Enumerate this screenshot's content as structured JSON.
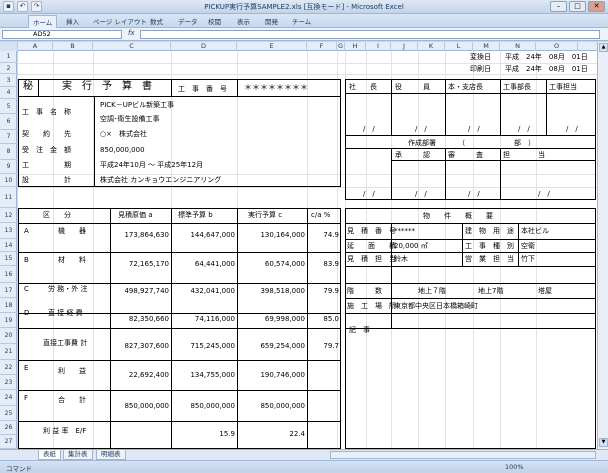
{
  "window": {
    "title": "PICKUP実行予算SAMPLE2.xls [互換モード] - Microsoft Excel",
    "minimize": "–",
    "maximize": "□",
    "close": "✕"
  },
  "qat": {
    "undo": "↶",
    "redo": "↷",
    "save": "▪"
  },
  "ribbon": {
    "tabs": [
      "ホーム",
      "挿入",
      "ページ レイアウト",
      "数式",
      "データ",
      "校閲",
      "表示",
      "開発",
      "チーム"
    ]
  },
  "formula_bar": {
    "name_box": "AD52",
    "fx": "fx",
    "value": ""
  },
  "columns": [
    "A",
    "B",
    "C",
    "D",
    "E",
    "F",
    "G",
    "H",
    "I",
    "J",
    "K",
    "L",
    "M",
    "N",
    "O"
  ],
  "rows": [
    "1",
    "2",
    "3",
    "4",
    "5",
    "6",
    "7",
    "8",
    "9",
    "10",
    "11",
    "12",
    "13",
    "14",
    "15",
    "16",
    "17",
    "18",
    "19",
    "20",
    "21",
    "22",
    "23",
    "24",
    "25",
    "26",
    "27"
  ],
  "header": {
    "change_date_label": "変換日",
    "change_date": "平成　24年　08月　01日",
    "print_date_label": "印刷日",
    "print_date": "平成　24年　08月　01日"
  },
  "left_block": {
    "secret": "秘",
    "doc_title": "実　行　予　算　書",
    "job_no_label": "工　事　番　号",
    "job_no": "＊＊＊＊＊＊＊＊",
    "fields": [
      {
        "label": "工　事　名　称",
        "value": "PICK－UPビル新築工事"
      },
      {
        "label": "",
        "value": "空調･衛生設備工事"
      },
      {
        "label": "契　　約　　先",
        "value": "○×　株式会社"
      },
      {
        "label": "受　注　金　額",
        "value": "850,000,000"
      },
      {
        "label": "工　　　　　期",
        "value": "平成24年10月 ～ 平成25年12月"
      },
      {
        "label": "設　　　　　計",
        "value": "株式会社 カンキョウエンジニアリング"
      }
    ]
  },
  "approval": {
    "roles": [
      "社　　長",
      "役　　　員",
      "本・支店長",
      "工事部長",
      "工事担当"
    ],
    "dates": [
      "/　/",
      "/　/",
      "/　/",
      "/　/",
      "/　/"
    ],
    "dept_label": "作成部署",
    "dept_value": "（　　　　　　　部　）",
    "roles2": [
      "承　　　認",
      "審　　　査",
      "担　　　　当"
    ],
    "dates2": [
      "/　/",
      "/　/",
      "/　/",
      "/　/"
    ]
  },
  "budget": {
    "headers": [
      "区　　分",
      "見積原価 a",
      "標準予算 b",
      "実行予算 c",
      "c/a %"
    ],
    "rows": [
      {
        "code": "A",
        "name": "機　　器",
        "a": "173,864,630",
        "b": "144,647,000",
        "c": "130,164,000",
        "pct": "74.9"
      },
      {
        "code": "B",
        "name": "材　　料",
        "a": "72,165,170",
        "b": "64,441,000",
        "c": "60,574,000",
        "pct": "83.9"
      },
      {
        "code": "C",
        "name": "労 務・外 注",
        "a": "498,927,740",
        "b": "432,041,000",
        "c": "398,518,000",
        "pct": "79.9"
      },
      {
        "code": "D",
        "name": "直 接 経 費",
        "a": "82,350,660",
        "b": "74,116,000",
        "c": "69,998,000",
        "pct": "85.0"
      },
      {
        "code": "",
        "name": "直接工事費 計",
        "a": "827,307,600",
        "b": "715,245,000",
        "c": "659,254,000",
        "pct": "79.7"
      },
      {
        "code": "E",
        "name": "利　　益",
        "a": "22,692,400",
        "b": "134,755,000",
        "c": "190,746,000",
        "pct": ""
      },
      {
        "code": "F",
        "name": "合　　計",
        "a": "850,000,000",
        "b": "850,000,000",
        "c": "850,000,000",
        "pct": ""
      },
      {
        "code": "",
        "name": "利 益 率　E/F",
        "a": "",
        "b": "15.9",
        "c": "22.4",
        "pct": ""
      }
    ]
  },
  "property": {
    "title": "物　　件　　概　　要",
    "rows": [
      {
        "l1": "見　積　番　号",
        "v1": "******",
        "l2": "建　物　用　途",
        "v2": "本社ビル"
      },
      {
        "l1": "延　　面　　積",
        "v1": "20,000 ㎡",
        "l2": "工　事　種　別",
        "v2": "空衛"
      },
      {
        "l1": "見　積　担　当",
        "v1": "鈴木",
        "l2": "営　業　担　当",
        "v2": "竹下"
      }
    ],
    "floors_label": "階　　　数",
    "above": "地上７階",
    "below": "地上7階",
    "tower": "塔屋",
    "site_label": "施　工　場　所",
    "site": "東京都中央区日本橋箱崎町",
    "notes_label": "記　事"
  },
  "sheet_tabs": [
    "表紙",
    "集計表",
    "明細表"
  ],
  "status": {
    "mode": "コマンド",
    "zoom": "100%"
  }
}
